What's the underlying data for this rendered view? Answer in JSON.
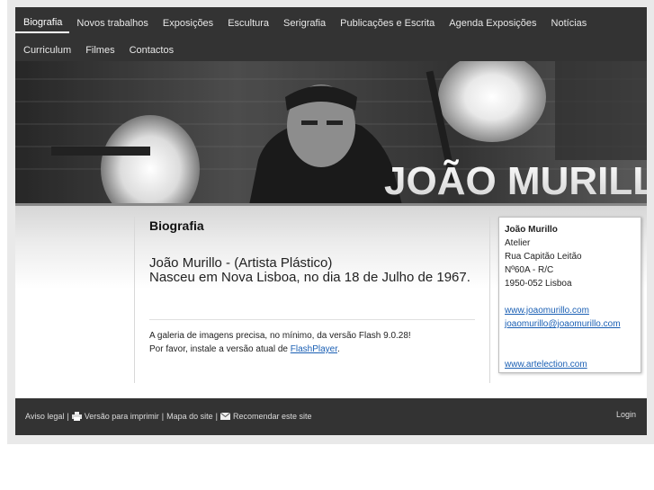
{
  "nav": {
    "row1": [
      "Biografia",
      "Novos trabalhos",
      "Exposições",
      "Escultura",
      "Serigrafia",
      "Publicações e Escrita",
      "Agenda Exposições",
      "Notícias"
    ],
    "row2": [
      "Curriculum",
      "Filmes",
      "Contactos"
    ],
    "active": "Biografia"
  },
  "banner": {
    "title": "JOÃO MURILLO"
  },
  "main": {
    "title": "Biografia",
    "intro_line1": "João Murillo - (Artista Plástico)",
    "intro_line2": "Nasceu em Nova Lisboa, no dia 18 de Julho de 1967.",
    "flash_line1": "A galeria de imagens precisa, no mínimo, da versão Flash 9.0.28!",
    "flash_line2_prefix": "Por favor, instale a versão atual de ",
    "flash_link": "FlashPlayer",
    "flash_line2_suffix": "."
  },
  "sidebox": {
    "name": "João Murillo",
    "lines": [
      "Atelier",
      "Rua Capitão Leitão",
      "Nº60A - R/C",
      "1950-052 Lisboa"
    ],
    "website": "www.joaomurillo.com",
    "email": "joaomurillo@joaomurillo.com",
    "link2": "www.artelection.com"
  },
  "footer": {
    "legal": "Aviso legal",
    "print": "Versão para imprimir",
    "sitemap": "Mapa do site",
    "recommend": "Recomendar este site",
    "login": "Login",
    "sep": "|"
  },
  "colors": {
    "nav_bg": "#333333",
    "link": "#1a5fb4",
    "footer_bg": "#333333"
  }
}
